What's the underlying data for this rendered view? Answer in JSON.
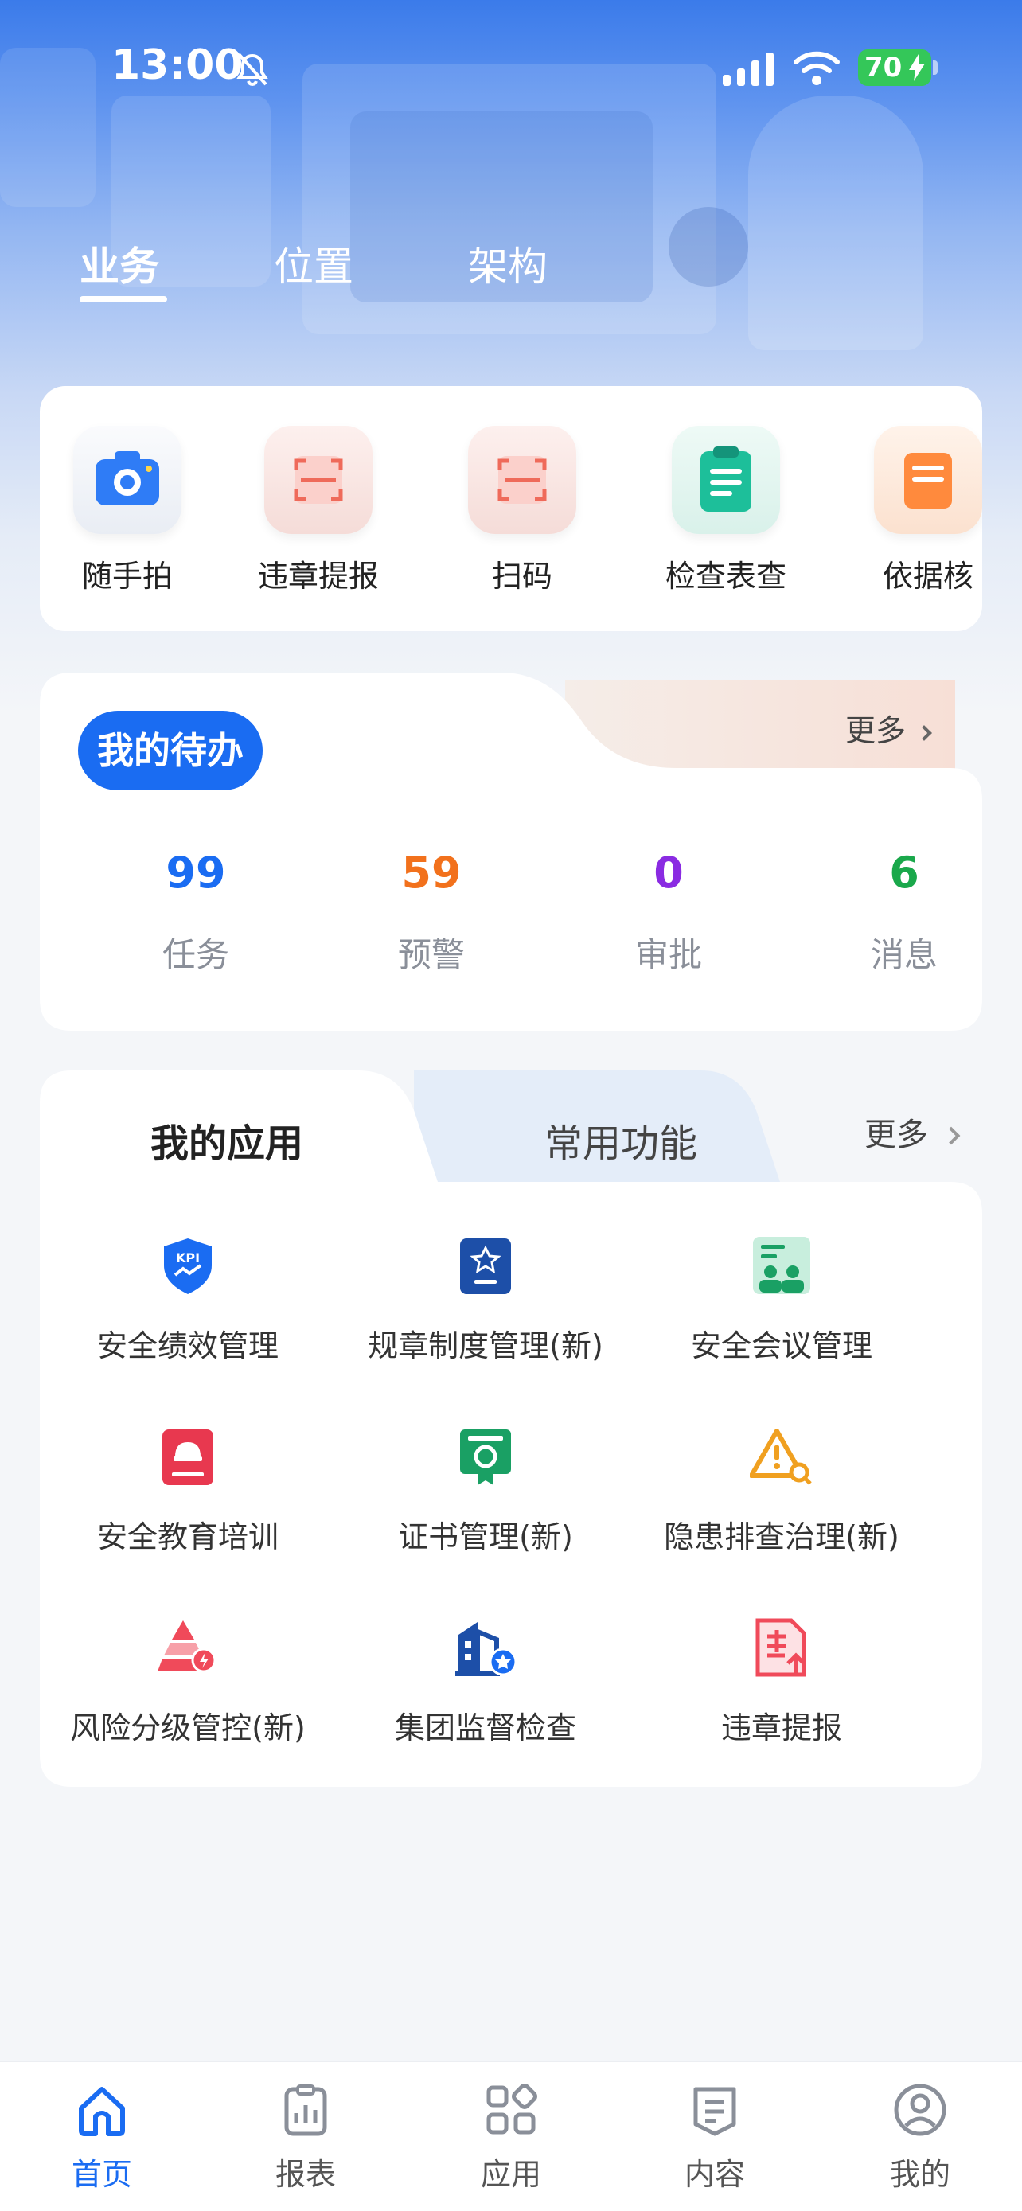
{
  "status_bar": {
    "time": "13:00",
    "battery": "70"
  },
  "top_tabs": {
    "items": [
      {
        "label": "业务"
      },
      {
        "label": "位置"
      },
      {
        "label": "架构"
      }
    ],
    "active": "业务"
  },
  "quick_actions": [
    {
      "label": "随手拍",
      "icon": "camera-icon"
    },
    {
      "label": "违章提报",
      "icon": "scan-frame-icon"
    },
    {
      "label": "扫码",
      "icon": "scan-code-icon"
    },
    {
      "label": "检查表查",
      "icon": "checklist-icon"
    },
    {
      "label": "依据核",
      "icon": "document-icon"
    }
  ],
  "todo": {
    "title": "我的待办",
    "more": "更多",
    "stats": [
      {
        "value": "99",
        "label": "任务",
        "color": "#1a6cf2"
      },
      {
        "value": "59",
        "label": "预警",
        "color": "#f2711c"
      },
      {
        "value": "0",
        "label": "审批",
        "color": "#8a2be2"
      },
      {
        "value": "6",
        "label": "消息",
        "color": "#1aa84b"
      }
    ]
  },
  "apps": {
    "tab_active": "我的应用",
    "tab_other": "常用功能",
    "more": "更多",
    "items": [
      {
        "label": "安全绩效管理",
        "icon": "kpi-shield-icon"
      },
      {
        "label": "规章制度管理(新)",
        "icon": "rules-book-icon"
      },
      {
        "label": "安全会议管理",
        "icon": "meeting-icon"
      },
      {
        "label": "安全教育培训",
        "icon": "training-book-icon"
      },
      {
        "label": "证书管理(新)",
        "icon": "certificate-icon"
      },
      {
        "label": "隐患排查治理(新)",
        "icon": "hazard-search-icon"
      },
      {
        "label": "风险分级管控(新)",
        "icon": "risk-pyramid-icon"
      },
      {
        "label": "集团监督检查",
        "icon": "building-star-icon"
      },
      {
        "label": "违章提报",
        "icon": "violation-report-icon"
      }
    ]
  },
  "tab_bar": {
    "items": [
      {
        "label": "首页",
        "icon": "home-icon"
      },
      {
        "label": "报表",
        "icon": "report-icon"
      },
      {
        "label": "应用",
        "icon": "apps-grid-icon"
      },
      {
        "label": "内容",
        "icon": "content-icon"
      },
      {
        "label": "我的",
        "icon": "profile-icon"
      }
    ],
    "active": "首页"
  },
  "colors": {
    "primary": "#1a6cf2",
    "warning": "#f2711c",
    "approval": "#8a2be2",
    "message": "#1aa84b"
  }
}
